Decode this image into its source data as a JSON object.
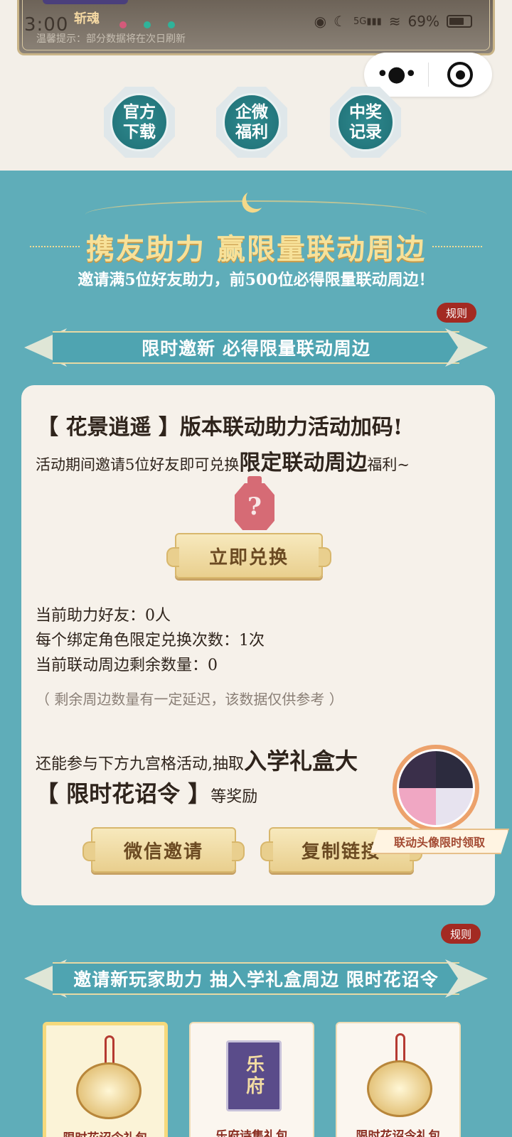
{
  "status_bar": {
    "time": "3:00",
    "signal": "5G",
    "battery": "69%"
  },
  "banner": {
    "nickname": "斩魂",
    "hint": "温馨提示：部分数据将在次日刷新"
  },
  "capsule": {
    "more_icon": "more-dots-icon",
    "close_icon": "target-circle-icon"
  },
  "quick_links": [
    {
      "label": "官方下载"
    },
    {
      "label": "企微福利"
    },
    {
      "label": "中奖记录"
    }
  ],
  "hero": {
    "title": "携友助力 赢限量联动周边",
    "subtitle": "邀请满5位好友助力，前500位必得限量联动周边！"
  },
  "section1": {
    "rule_label": "规则",
    "ribbon": "限时邀新 必得限量联动周边",
    "title": "【 花景逍遥 】版本联动助力活动加码!",
    "desc_prefix": "活动期间邀请5位好友即可兑换",
    "desc_highlight": "限定联动周边",
    "desc_suffix": "福利~",
    "mystery_mark": "?",
    "redeem_button": "立即兑换",
    "stats": [
      "当前助力好友：0人",
      "每个绑定角色限定兑换次数：1次",
      "当前联动周边剩余数量：0"
    ],
    "note": "（ 剩余周边数量有一定延迟，该数据仅供参考 ）",
    "also_prefix": "还能参与下方九宫格活动,抽取",
    "also_highlight": "入学礼盒大",
    "also2_highlight": "【 限时花诏令 】",
    "also2_suffix": "等奖励",
    "invite_button": "微信邀请",
    "copy_button": "复制链接",
    "avatar_badge_label": "联动头像限时领取"
  },
  "section2": {
    "rule_label": "规则",
    "ribbon": "邀请新玩家助力 抽入学礼盒周边 限时花诏令",
    "gifts": [
      {
        "label": "限时花诏令礼包",
        "selected": true
      },
      {
        "label": "乐府诗集礼包",
        "book_title": "乐府",
        "selected": false
      },
      {
        "label": "限时花诏令礼包",
        "selected": false
      }
    ]
  }
}
